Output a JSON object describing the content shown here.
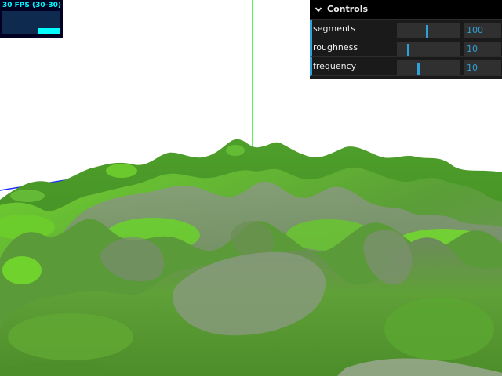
{
  "stats": {
    "fps_text": "30 FPS (30-30)",
    "fps": 30,
    "fps_min": 30,
    "fps_max": 30
  },
  "gui": {
    "title": "Controls",
    "controls": [
      {
        "label": "segments",
        "value": "100",
        "fraction": 0.47
      },
      {
        "label": "roughness",
        "value": "10",
        "fraction": 0.17
      },
      {
        "label": "frequency",
        "value": "10",
        "fraction": 0.33
      }
    ]
  },
  "scene": {
    "sky_color": "#ffffff",
    "terrain_light": "#7cd83a",
    "terrain_mid": "#4f9a2c",
    "terrain_shade": "#6f7f68",
    "axis_x_color": "#ff2a1a",
    "axis_y_color": "#22ee22",
    "axis_z_color": "#1a2aff"
  }
}
